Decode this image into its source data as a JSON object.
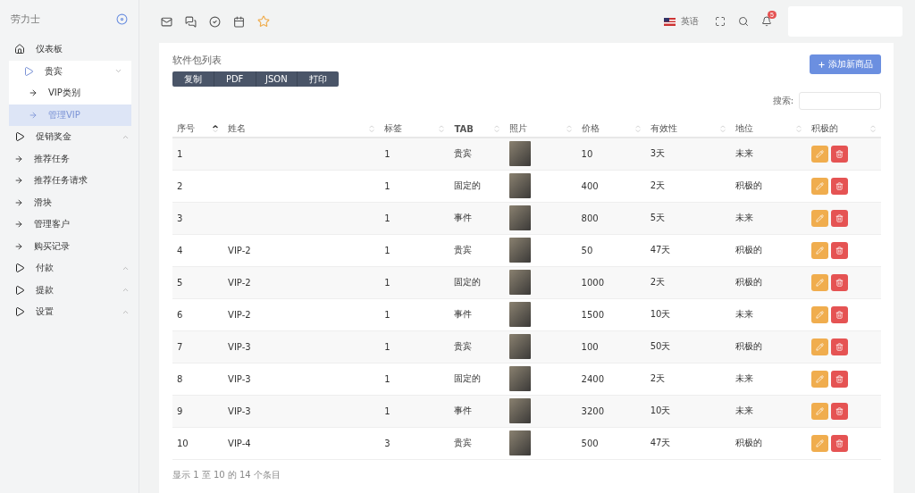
{
  "sidebar": {
    "brand": "劳力士",
    "items": [
      {
        "kind": "home",
        "label": "仪表板",
        "selected": false
      },
      {
        "kind": "group",
        "label": "贵宾",
        "selected": false,
        "expanded": true,
        "children": [
          {
            "kind": "link",
            "label": "VIP类别",
            "selected": false
          },
          {
            "kind": "link",
            "label": "管理VIP",
            "selected": true
          }
        ]
      },
      {
        "kind": "group",
        "label": "促销奖金",
        "selected": false,
        "expanded": false
      },
      {
        "kind": "link",
        "label": "推荐任务",
        "selected": false
      },
      {
        "kind": "link",
        "label": "推荐任务请求",
        "selected": false
      },
      {
        "kind": "link",
        "label": "滑块",
        "selected": false
      },
      {
        "kind": "link",
        "label": "管理客户",
        "selected": false
      },
      {
        "kind": "link",
        "label": "购买记录",
        "selected": false
      },
      {
        "kind": "group",
        "label": "付款",
        "selected": false,
        "expanded": false
      },
      {
        "kind": "group",
        "label": "提款",
        "selected": false,
        "expanded": false
      },
      {
        "kind": "group",
        "label": "设置",
        "selected": false,
        "expanded": false
      }
    ]
  },
  "topbar": {
    "language": "英语",
    "notifications": "5"
  },
  "card": {
    "title": "软件包列表",
    "export_buttons": [
      "复制",
      "PDF",
      "JSON",
      "打印"
    ],
    "add_button": "添加新商品",
    "search_label": "搜索:"
  },
  "table": {
    "columns": [
      {
        "label": "序号",
        "sorted": true
      },
      {
        "label": "姓名",
        "sorted": false
      },
      {
        "label": "标签",
        "sorted": false
      },
      {
        "label": "TAB",
        "sorted": false
      },
      {
        "label": "照片",
        "sorted": false
      },
      {
        "label": "价格",
        "sorted": false
      },
      {
        "label": "有效性",
        "sorted": false
      },
      {
        "label": "地位",
        "sorted": false
      },
      {
        "label": "积极的",
        "sorted": false
      }
    ],
    "rows": [
      {
        "no": "1",
        "tag": "1",
        "tab": "贵宾",
        "price": "10",
        "validity": "3天",
        "status": "未来"
      },
      {
        "no": "2",
        "tag": "1",
        "tab": "固定的",
        "price": "400",
        "validity": "2天",
        "status": "积极的"
      },
      {
        "no": "3",
        "tag": "1",
        "tab": "事件",
        "price": "800",
        "validity": "5天",
        "status": "未来"
      },
      {
        "no": "4",
        "name": "VIP-2",
        "tag": "1",
        "tab": "贵宾",
        "price": "50",
        "validity": "47天",
        "status": "积极的"
      },
      {
        "no": "5",
        "name": "VIP-2",
        "tag": "1",
        "tab": "固定的",
        "price": "1000",
        "validity": "2天",
        "status": "积极的"
      },
      {
        "no": "6",
        "name": "VIP-2",
        "tag": "1",
        "tab": "事件",
        "price": "1500",
        "validity": "10天",
        "status": "未来"
      },
      {
        "no": "7",
        "name": "VIP-3",
        "tag": "1",
        "tab": "贵宾",
        "price": "100",
        "validity": "50天",
        "status": "积极的"
      },
      {
        "no": "8",
        "name": "VIP-3",
        "tag": "1",
        "tab": "固定的",
        "price": "2400",
        "validity": "2天",
        "status": "未来"
      },
      {
        "no": "9",
        "name": "VIP-3",
        "tag": "1",
        "tab": "事件",
        "price": "3200",
        "validity": "10天",
        "status": "未来"
      },
      {
        "no": "10",
        "name": "VIP-4",
        "tag": "3",
        "tab": "贵宾",
        "price": "500",
        "validity": "47天",
        "status": "积极的"
      }
    ],
    "footer": "显示 1 至 10 的 14 个条目"
  }
}
